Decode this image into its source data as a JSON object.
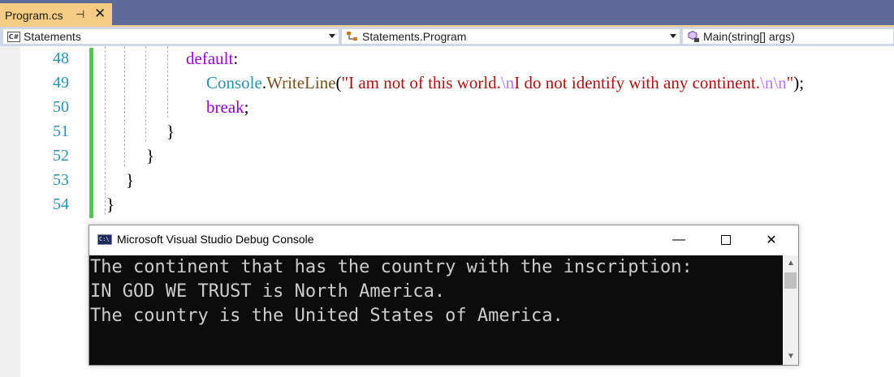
{
  "tab": {
    "title": "Program.cs",
    "pin": "⊣",
    "close": "✕"
  },
  "navbar": {
    "project": "Statements",
    "project_icon": "C#",
    "type": "Statements.Program",
    "member": "Main(string[] args)"
  },
  "editor": {
    "line_numbers": [
      "48",
      "49",
      "50",
      "51",
      "52",
      "53",
      "54"
    ],
    "lines": {
      "l48_kw": "default",
      "l48_punct": ":",
      "l49_class": "Console",
      "l49_dot": ".",
      "l49_method": "WriteLine",
      "l49_open": "(",
      "l49_str1": "\"I am not of this world.",
      "l49_esc1": "\\n",
      "l49_str2": "I do not identify with any continent.",
      "l49_esc2": "\\n\\n",
      "l49_str3": "\"",
      "l49_close": ");",
      "l50_kw": "break",
      "l50_punct": ";",
      "l51": "}",
      "l52": "}",
      "l53": "}",
      "l54": "}"
    }
  },
  "console": {
    "title": "Microsoft Visual Studio Debug Console",
    "icon_text": "C:\\",
    "minimize": "—",
    "close": "✕",
    "output": [
      "The continent that has the country with the inscription:",
      "IN GOD WE TRUST is North America.",
      "The country is the United States of America."
    ],
    "scroll_up": "▲",
    "scroll_down": "▼"
  },
  "colors": {
    "keyword": "#8f08c4",
    "class": "#2b91af",
    "method": "#74531f",
    "string": "#a31515",
    "escape": "#b776fb",
    "line_number": "#2b91af",
    "change_bar": "#57c35a",
    "tab_active": "#f5cc84"
  }
}
